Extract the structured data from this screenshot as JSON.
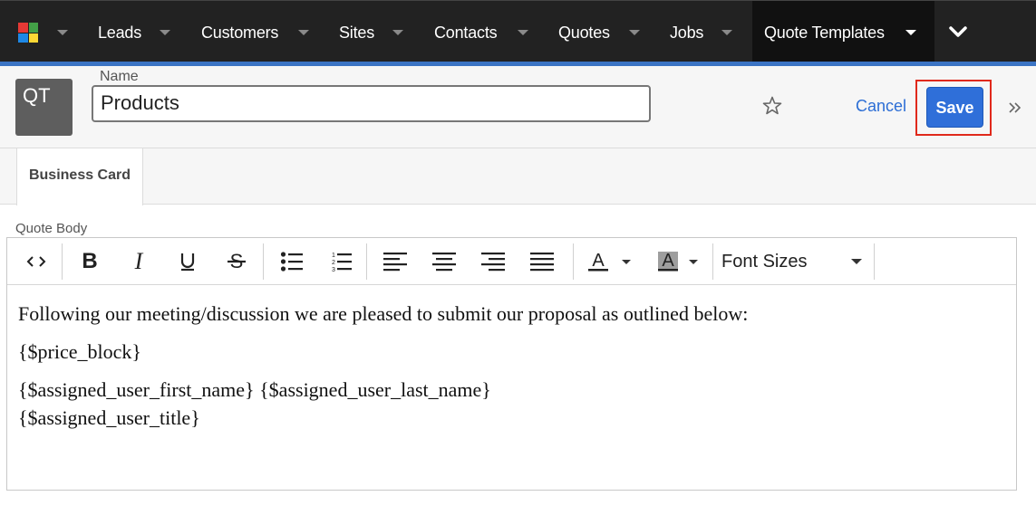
{
  "nav": {
    "items": [
      "Leads",
      "Customers",
      "Sites",
      "Contacts",
      "Quotes",
      "Jobs",
      "Quote Templates"
    ],
    "active_index": 6,
    "logo_colors": [
      "#e53935",
      "#43a047",
      "#1e88e5",
      "#fdd835"
    ]
  },
  "header": {
    "avatar_initials": "QT",
    "name_label": "Name",
    "name_value": "Products",
    "cancel_label": "Cancel",
    "save_label": "Save"
  },
  "tabs": [
    {
      "label": "Business Card",
      "selected": true
    }
  ],
  "editor": {
    "label": "Quote Body",
    "font_sizes_label": "Font Sizes",
    "toolbar_icons": [
      "code-icon",
      "bold-icon",
      "italic-icon",
      "underline-icon",
      "strikethrough-icon",
      "bullet-list-icon",
      "numbered-list-icon",
      "align-left-icon",
      "align-center-icon",
      "align-right-icon",
      "align-justify-icon",
      "text-color-icon",
      "background-color-icon",
      "font-sizes-dropdown"
    ],
    "content": {
      "line1": "Following our meeting/discussion we are pleased to submit our proposal as outlined below:",
      "line2": "{$price_block}",
      "line3": "{$assigned_user_first_name} {$assigned_user_last_name}",
      "line4": "{$assigned_user_title}"
    }
  },
  "colors": {
    "nav_bg": "#222222",
    "accent": "#3b74c4",
    "save_button": "#2f6fd9",
    "highlight_frame": "#e0291b"
  }
}
